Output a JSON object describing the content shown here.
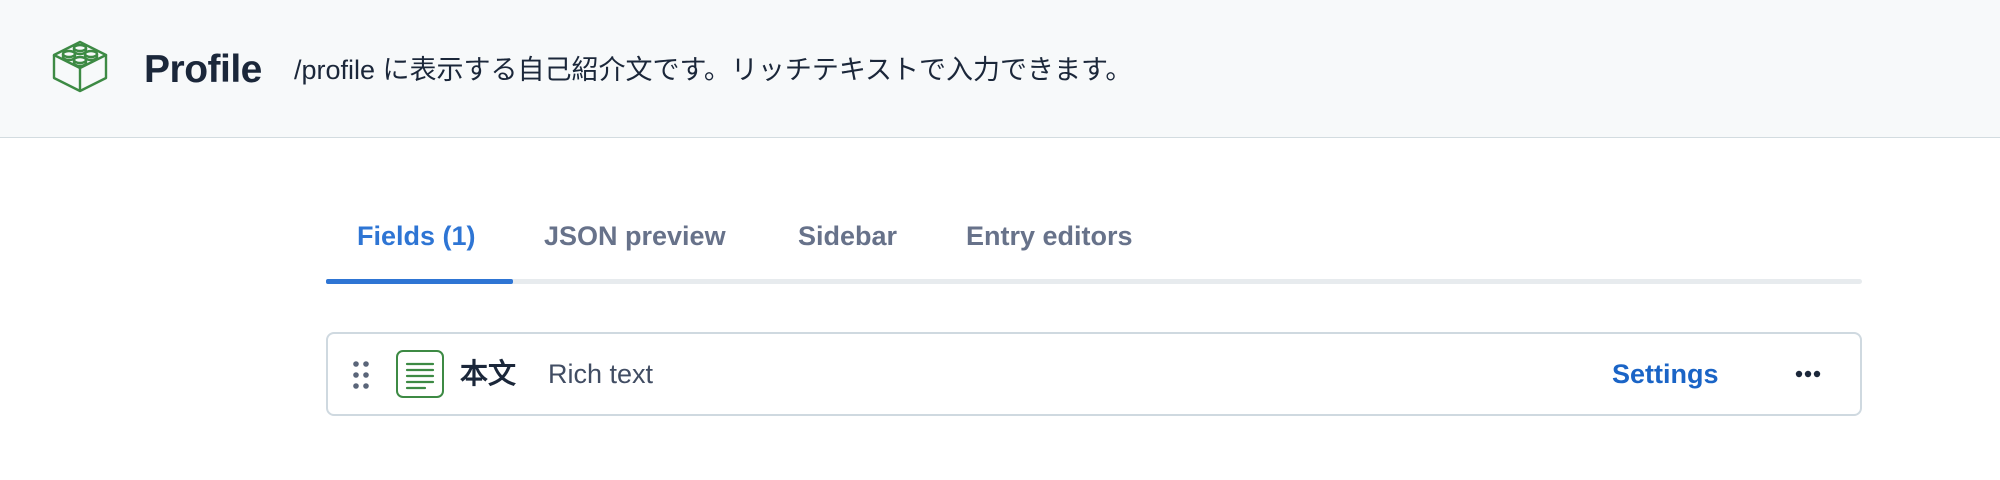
{
  "header": {
    "logo_icon": "content-type-block-icon",
    "title": "Profile",
    "description": "/profile に表示する自己紹介文です。リッチテキストで入力できます。"
  },
  "tabs": [
    {
      "label": "Fields (1)",
      "active": true
    },
    {
      "label": "JSON preview",
      "active": false
    },
    {
      "label": "Sidebar",
      "active": false
    },
    {
      "label": "Entry editors",
      "active": false
    }
  ],
  "fields": [
    {
      "name": "本文",
      "type_label": "Rich text",
      "type_icon": "rich-text-icon",
      "settings_label": "Settings",
      "more_icon": "more-horizontal-icon",
      "drag_icon": "drag-handle-icon"
    }
  ],
  "colors": {
    "accent": "#2e75d4",
    "link": "#1a64c6",
    "icon_green": "#3d8a44",
    "header_bg": "#f7f9fa",
    "tab_inactive": "#67728a"
  }
}
